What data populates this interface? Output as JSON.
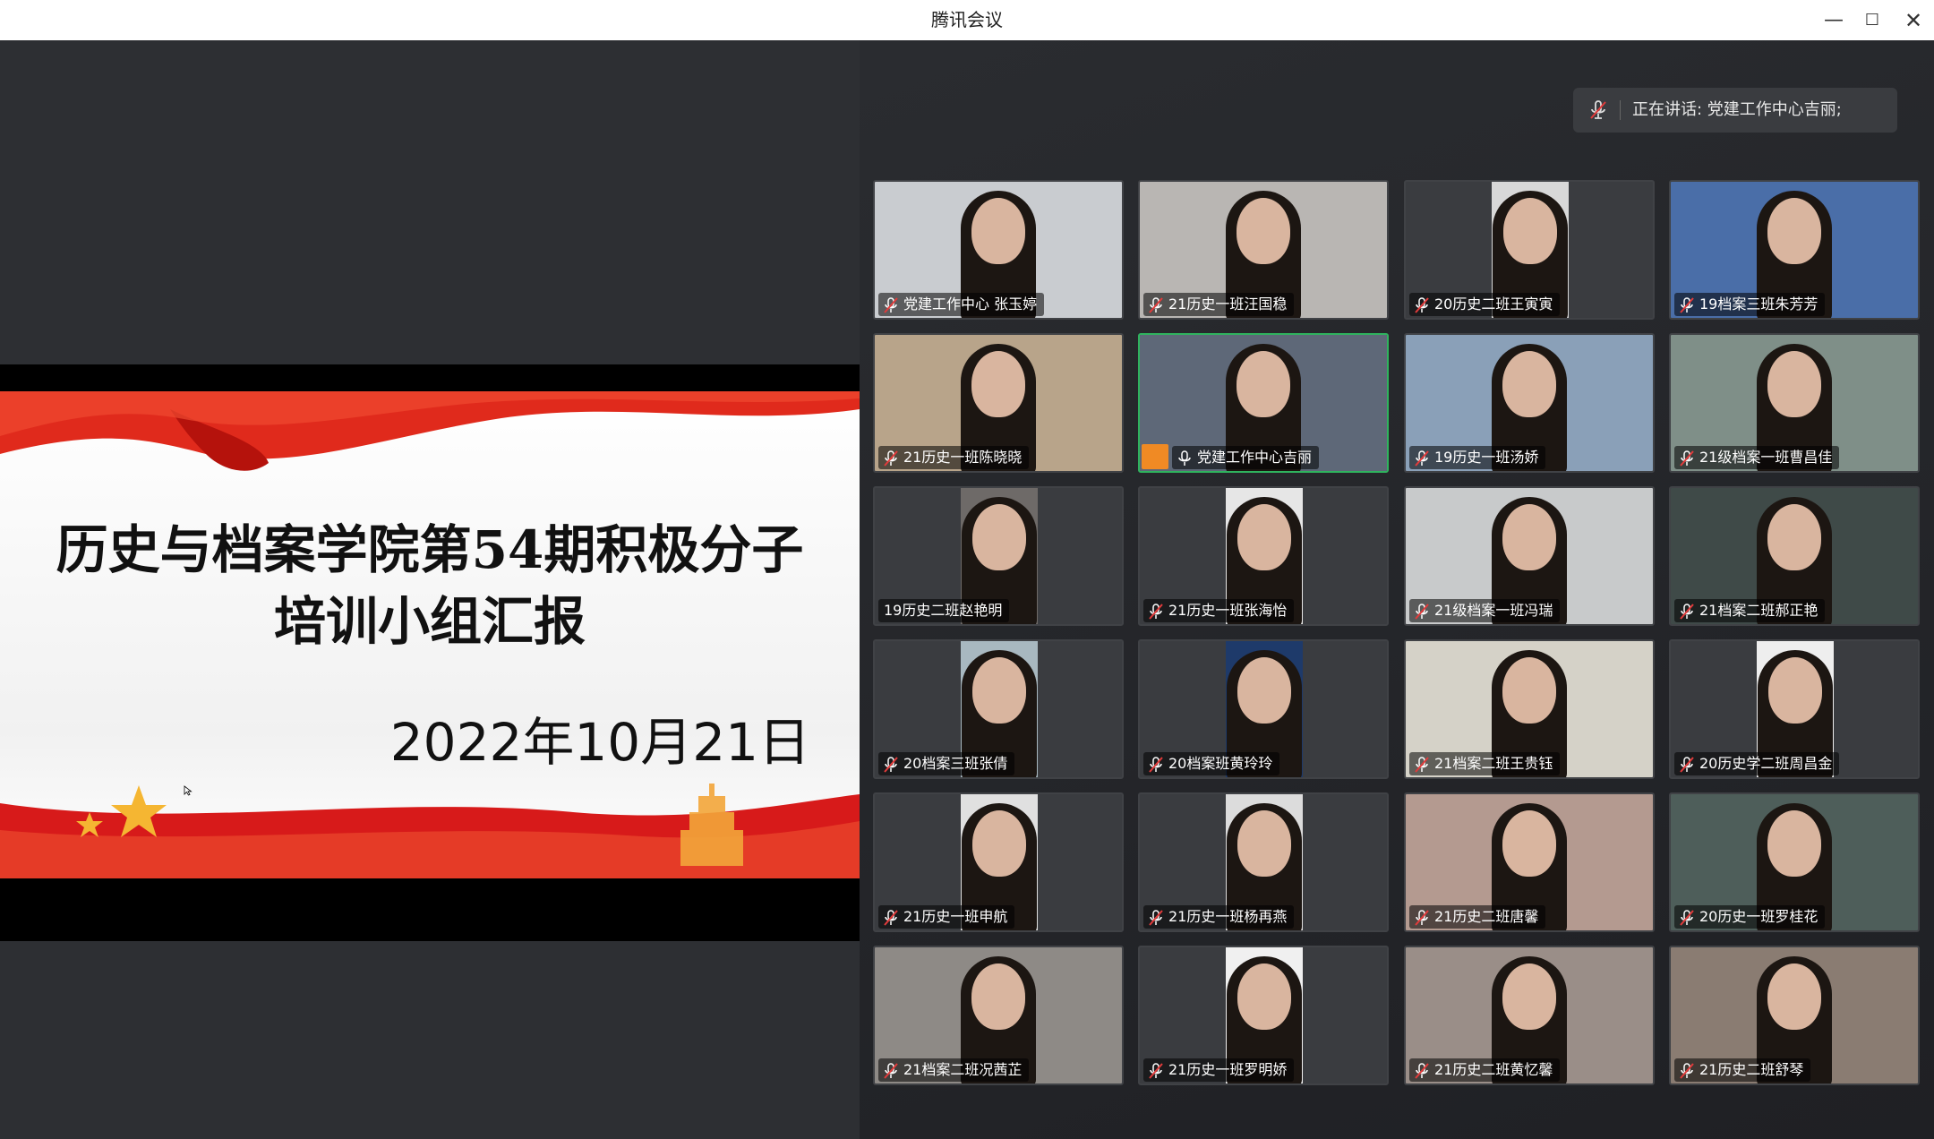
{
  "window": {
    "title": "腾讯会议"
  },
  "slide": {
    "title_line1": "历史与档案学院第54期积极分子",
    "title_line2": "培训小组汇报",
    "date": "2022年10月21日"
  },
  "speaking": {
    "text": "正在讲话: 党建工作中心吉丽;"
  },
  "colors": {
    "active_border": "#2fb35e",
    "accent_red": "#d71a1a",
    "muted_mic": "#e23b3b"
  },
  "participants": [
    {
      "name": "党建工作中心 张玉婷",
      "muted": true,
      "video": "full",
      "bg": "#c9ccd0"
    },
    {
      "name": "21历史一班汪国稳",
      "muted": true,
      "video": "full",
      "bg": "#b9b6b3"
    },
    {
      "name": "20历史二班王寅寅",
      "muted": true,
      "video": "portrait",
      "bg": "#d8d8d8"
    },
    {
      "name": "19档案三班朱芳芳",
      "muted": true,
      "video": "full",
      "bg": "#4a6ea8"
    },
    {
      "name": "21历史一班陈晓晓",
      "muted": true,
      "video": "full",
      "bg": "#b8a48a"
    },
    {
      "name": "党建工作中心吉丽",
      "muted": false,
      "active": true,
      "avatar": true,
      "video": "full",
      "bg": "#5e6878"
    },
    {
      "name": "19历史一班汤娇",
      "muted": true,
      "video": "full",
      "bg": "#8aa0b8"
    },
    {
      "name": "21级档案一班曹昌佳",
      "muted": true,
      "video": "full",
      "bg": "#7f8f88"
    },
    {
      "name": "19历史二班赵艳明",
      "muted": false,
      "nomic": true,
      "video": "portrait",
      "bg": "#6e6a68"
    },
    {
      "name": "21历史一班张海怡",
      "muted": true,
      "video": "portrait",
      "bg": "#e6e6e6"
    },
    {
      "name": "21级档案一班冯瑞",
      "muted": true,
      "video": "full",
      "bg": "#c8cacb"
    },
    {
      "name": "21档案二班郝正艳",
      "muted": true,
      "video": "full",
      "bg": "#3f4a48"
    },
    {
      "name": "20档案三班张倩",
      "muted": true,
      "video": "portrait",
      "bg": "#a8b8c0"
    },
    {
      "name": "20档案班黄玲玲",
      "muted": true,
      "video": "portrait",
      "bg": "#1e3a6a"
    },
    {
      "name": "21档案二班王贵钰",
      "muted": true,
      "video": "full",
      "bg": "#d5d2c8"
    },
    {
      "name": "20历史学二班周昌金",
      "muted": true,
      "video": "portrait",
      "bg": "#eeeeee"
    },
    {
      "name": "21历史一班申航",
      "muted": true,
      "video": "portrait",
      "bg": "#e0e0e0"
    },
    {
      "name": "21历史一班杨再燕",
      "muted": true,
      "video": "portrait",
      "bg": "#dcdcdc"
    },
    {
      "name": "21历史二班唐馨",
      "muted": true,
      "video": "full",
      "bg": "#b49a90"
    },
    {
      "name": "20历史一班罗桂花",
      "muted": true,
      "video": "full",
      "bg": "#4e5e5a"
    },
    {
      "name": "21档案二班况茜芷",
      "muted": true,
      "video": "full",
      "bg": "#8e8a86"
    },
    {
      "name": "21历史一班罗明娇",
      "muted": true,
      "video": "portrait",
      "bg": "#f0f0f0"
    },
    {
      "name": "21历史二班黄忆馨",
      "muted": true,
      "video": "full",
      "bg": "#9a8e88"
    },
    {
      "name": "21历史二班舒琴",
      "muted": true,
      "video": "full",
      "bg": "#8a7c72"
    }
  ]
}
